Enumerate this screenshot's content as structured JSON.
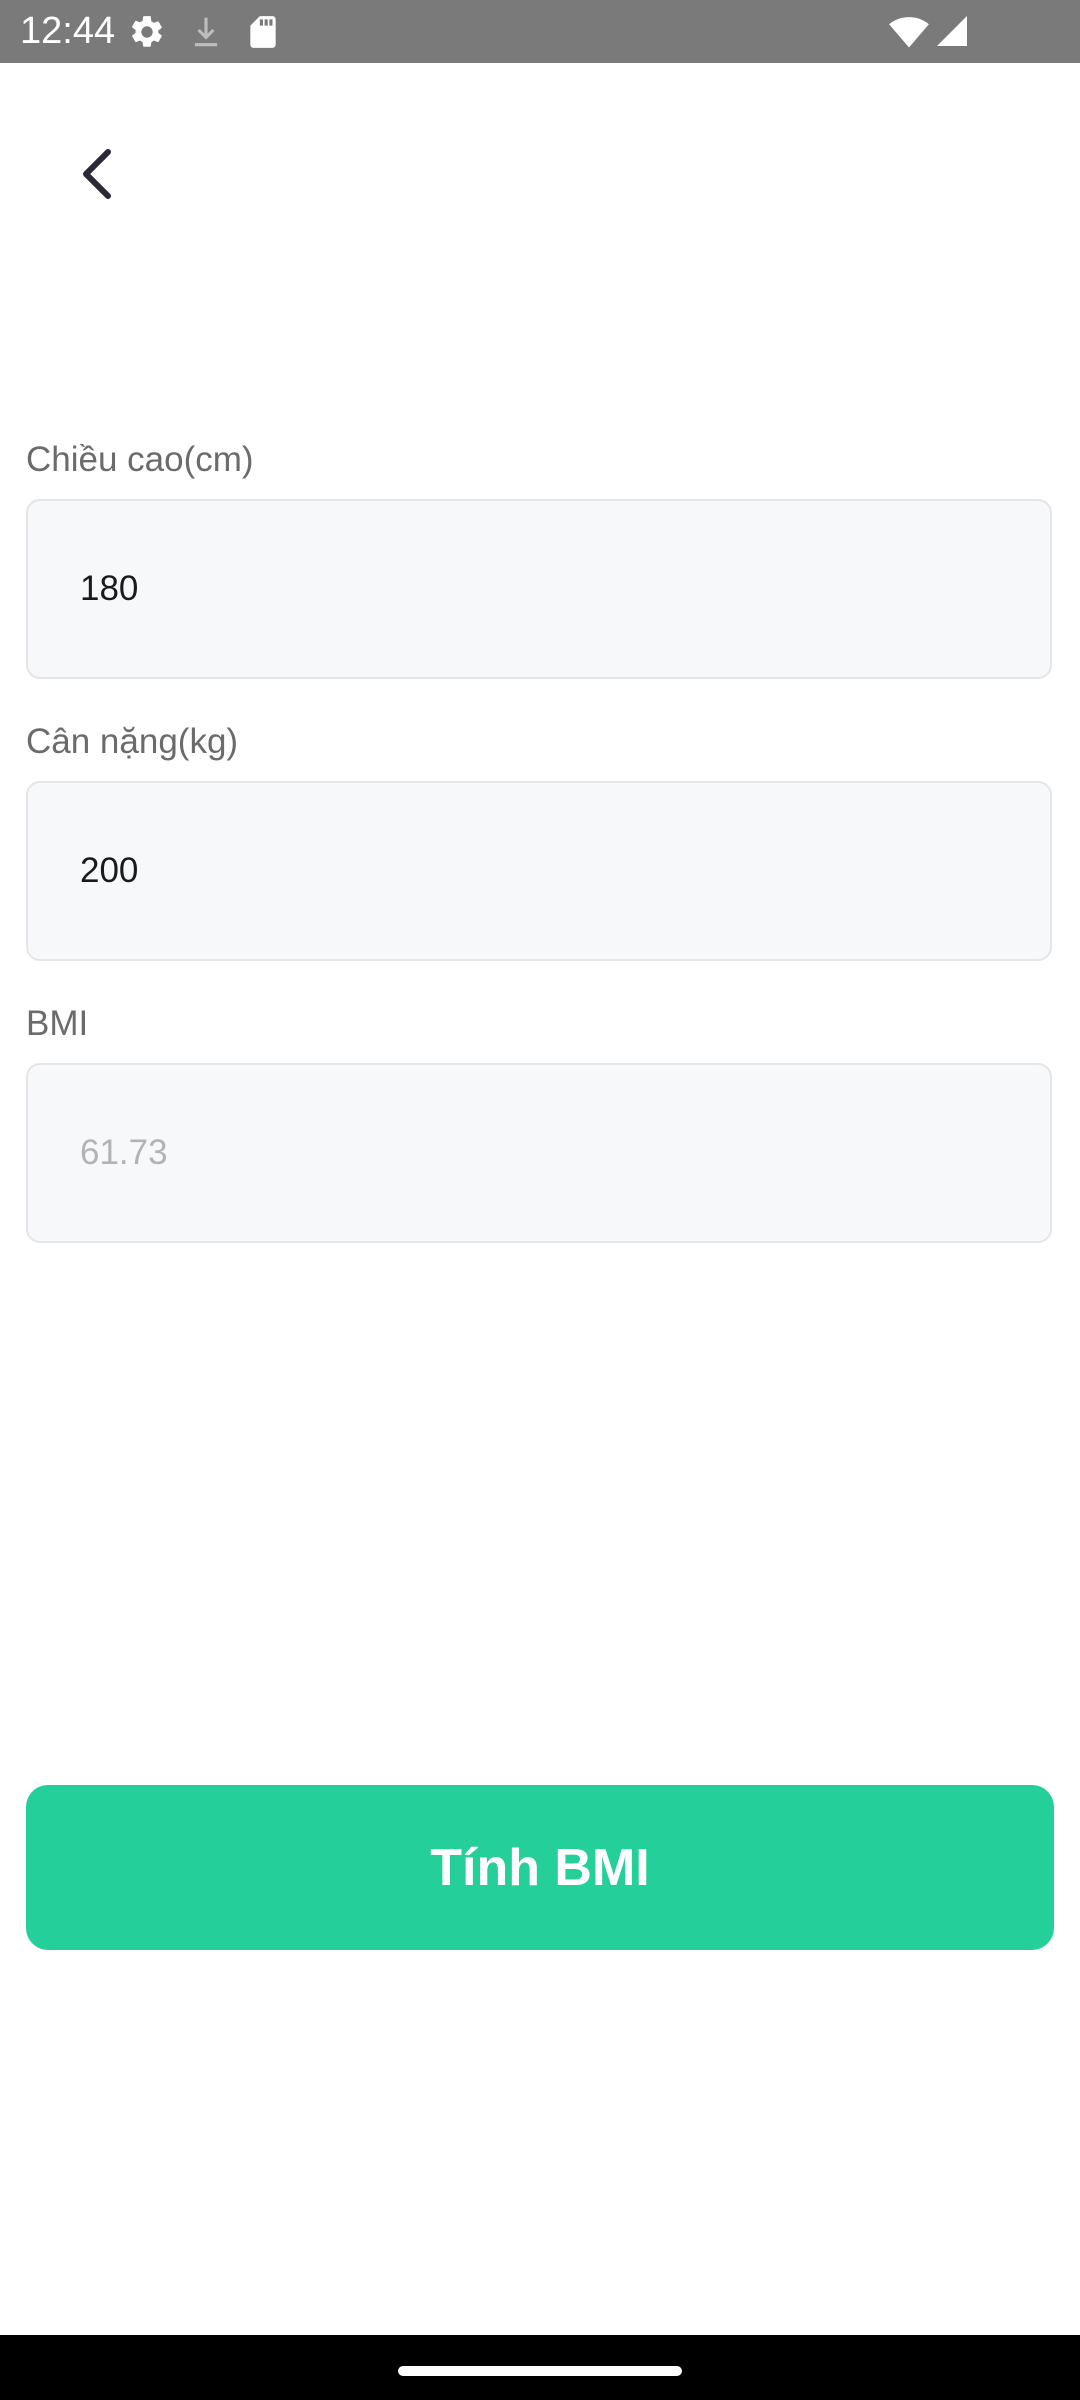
{
  "status_bar": {
    "time": "12:44",
    "icons": [
      "settings-gear-icon",
      "download-icon",
      "sd-card-icon",
      "wifi-icon",
      "cell-signal-icon"
    ]
  },
  "header": {
    "back_icon": "chevron-left-icon"
  },
  "form": {
    "height": {
      "label": "Chiều cao(cm)",
      "value": "180"
    },
    "weight": {
      "label": "Cân nặng(kg)",
      "value": "200"
    },
    "bmi": {
      "label": "BMI",
      "value": "61.73"
    }
  },
  "actions": {
    "calculate_label": "Tính BMI"
  },
  "colors": {
    "accent": "#24cf9a",
    "status_bar": "#7a7a7a",
    "field_bg": "#f7f8fa",
    "field_border": "#e3e5e8"
  }
}
